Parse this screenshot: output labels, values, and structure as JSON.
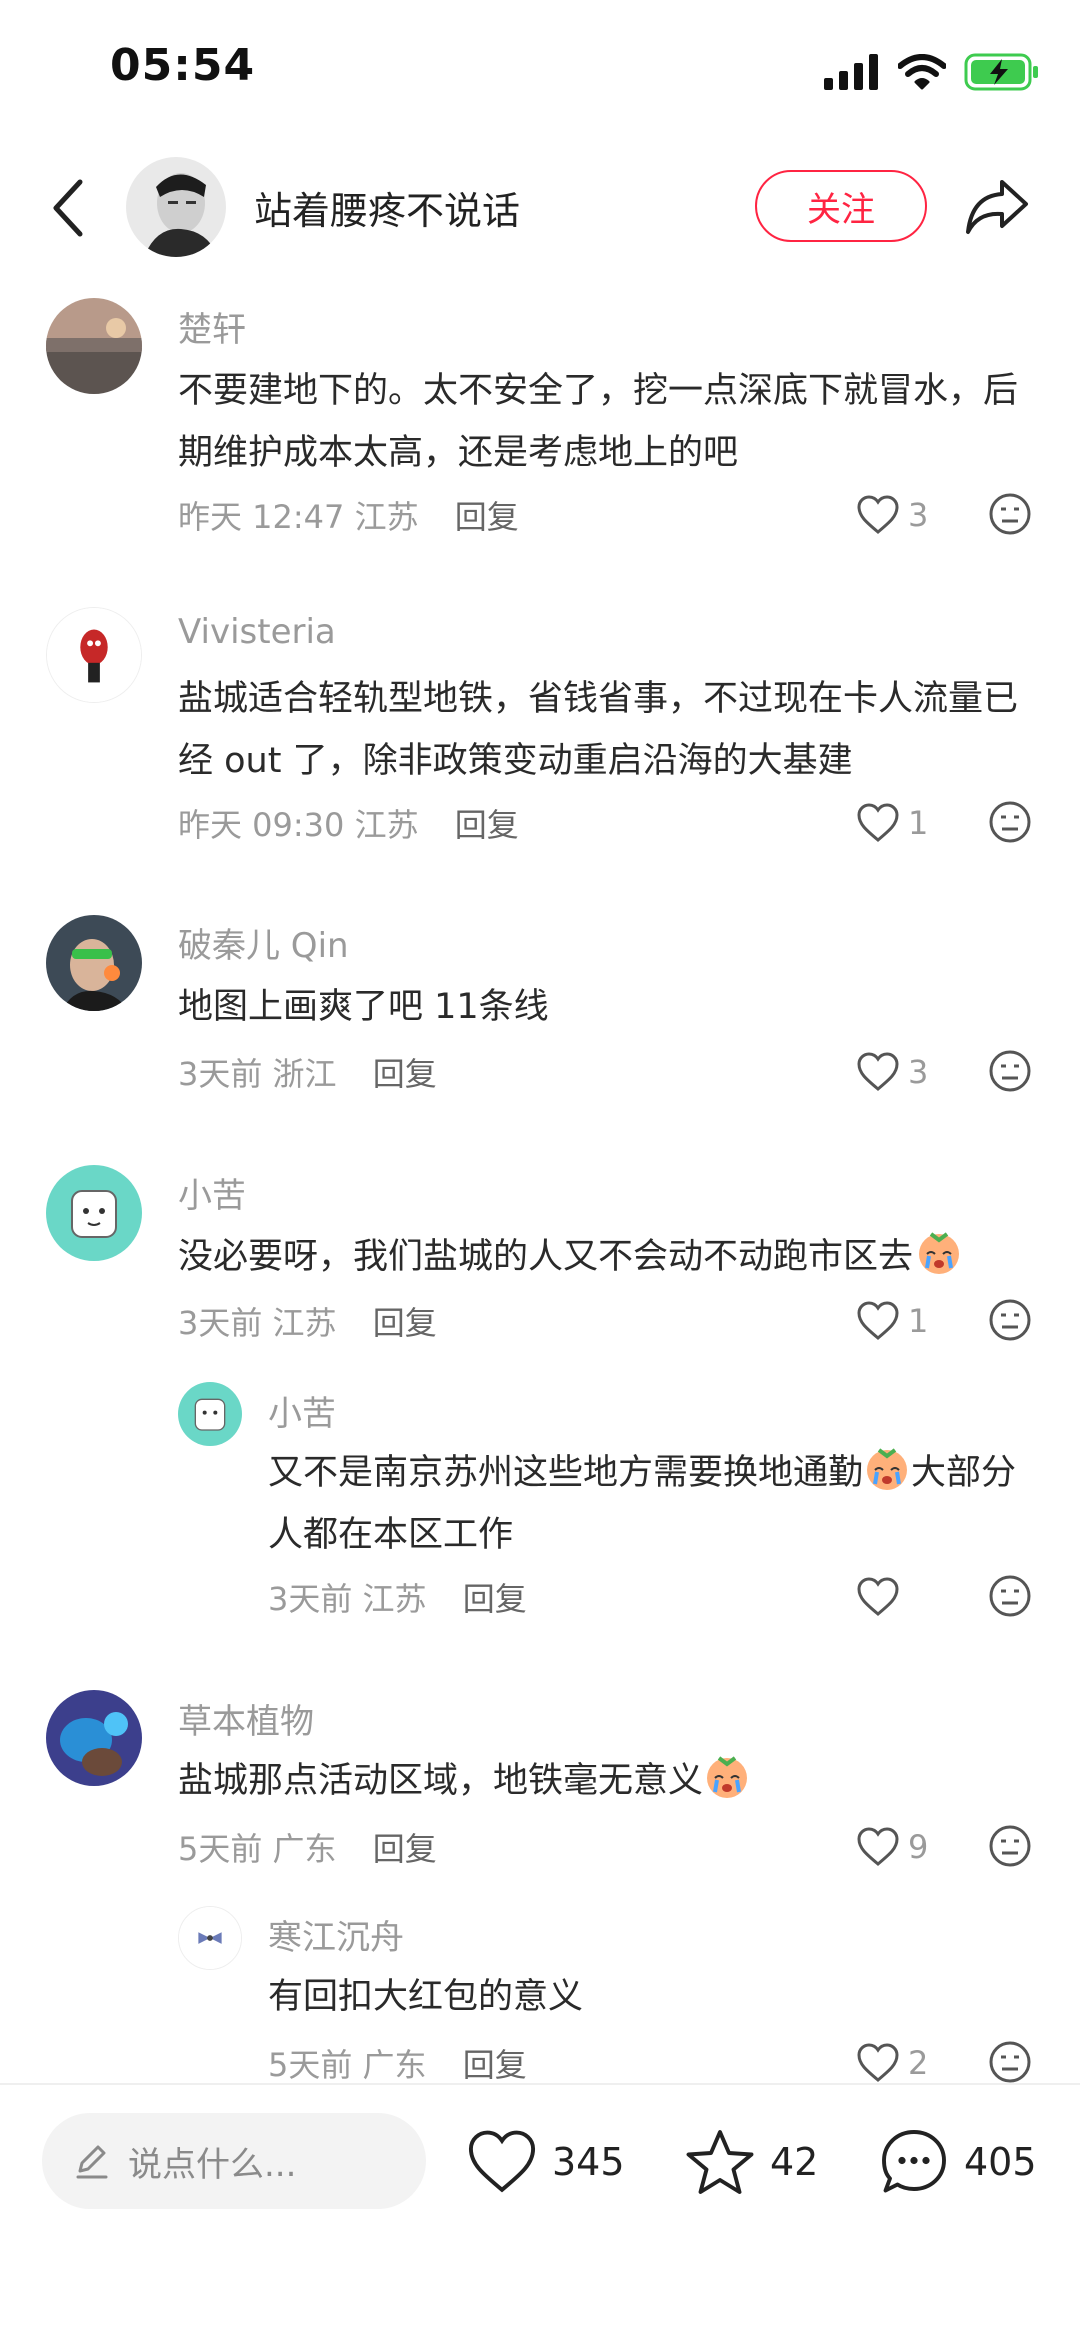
{
  "status_bar": {
    "time": "05:54"
  },
  "header": {
    "author": "站着腰疼不说话",
    "follow_label": "关注"
  },
  "comments": [
    {
      "name": "楚轩",
      "text": "不要建地下的。太不安全了，挖一点深底下就冒水，后期维护成本太高，还是考虑地上的吧",
      "time": "昨天 12:47",
      "region": "江苏",
      "reply": "回复",
      "likes": "3"
    },
    {
      "name": "Vivisteria",
      "text": "盐城适合轻轨型地铁，省钱省事，不过现在卡人流量已经 out 了，除非政策变动重启沿海的大基建",
      "time": "昨天 09:30",
      "region": "江苏",
      "reply": "回复",
      "likes": "1"
    },
    {
      "name": "破秦儿 Qin",
      "text": "地图上画爽了吧 11条线",
      "time": "3天前",
      "region": "浙江",
      "reply": "回复",
      "likes": "3"
    },
    {
      "name": "小苦",
      "text": "没必要呀，我们盐城的人又不会动不动跑市区去",
      "time": "3天前",
      "region": "江苏",
      "reply": "回复",
      "likes": "1"
    },
    {
      "name": "小苦",
      "text_a": "又不是南京苏州这些地方需要换地通勤",
      "text_b": "大部分人都在本区工作",
      "time": "3天前",
      "region": "江苏",
      "reply": "回复",
      "likes": ""
    },
    {
      "name": "草本植物",
      "text": "盐城那点活动区域，地铁毫无意义",
      "time": "5天前",
      "region": "广东",
      "reply": "回复",
      "likes": "9"
    },
    {
      "name": "寒江沉舟",
      "text": "有回扣大红包的意义",
      "time": "5天前",
      "region": "广东",
      "reply": "回复",
      "likes": "2"
    }
  ],
  "bottom_bar": {
    "input_placeholder": "说点什么...",
    "likes": "345",
    "favorites": "42",
    "comments": "405"
  },
  "colors": {
    "accent": "#ff2442",
    "battery": "#3ecb4f",
    "meta_text": "#9a9a9a"
  }
}
